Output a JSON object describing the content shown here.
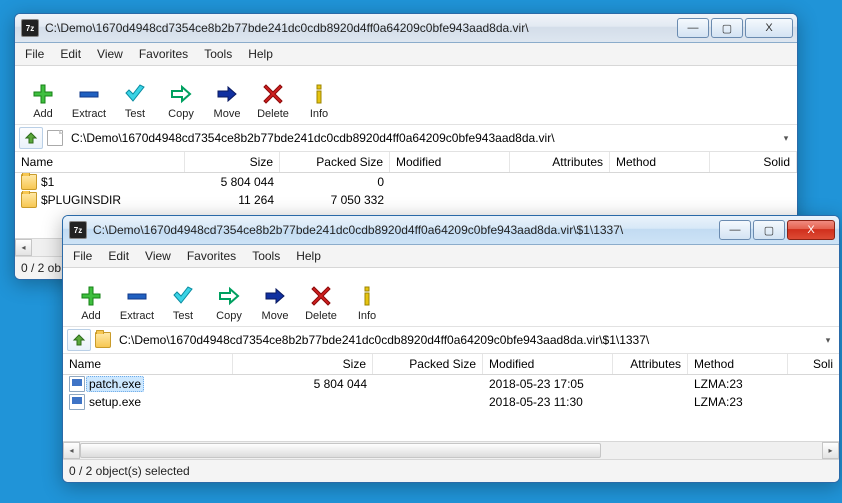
{
  "app_icon_label": "7z",
  "window1": {
    "title": "C:\\Demo\\1670d4948cd7354ce8b2b77bde241dc0cdb8920d4ff0a64209c0bfe943aad8da.vir\\",
    "win_min": "—",
    "win_max": "▢",
    "win_close": "X",
    "menu": [
      "File",
      "Edit",
      "View",
      "Favorites",
      "Tools",
      "Help"
    ],
    "tools": {
      "add": "Add",
      "extract": "Extract",
      "test": "Test",
      "copy": "Copy",
      "move": "Move",
      "delete": "Delete",
      "info": "Info"
    },
    "path": "C:\\Demo\\1670d4948cd7354ce8b2b77bde241dc0cdb8920d4ff0a64209c0bfe943aad8da.vir\\",
    "columns": {
      "name": "Name",
      "size": "Size",
      "packed": "Packed Size",
      "modified": "Modified",
      "attributes": "Attributes",
      "method": "Method",
      "solid": "Solid"
    },
    "rows": [
      {
        "name": "$1",
        "size": "5 804 044",
        "packed": "0",
        "modified": "",
        "attributes": "",
        "method": "",
        "solid": ""
      },
      {
        "name": "$PLUGINSDIR",
        "size": "11 264",
        "packed": "7 050 332",
        "modified": "",
        "attributes": "",
        "method": "",
        "solid": ""
      }
    ],
    "status_prefix": "0 / 2 ob"
  },
  "window2": {
    "title": "C:\\Demo\\1670d4948cd7354ce8b2b77bde241dc0cdb8920d4ff0a64209c0bfe943aad8da.vir\\$1\\1337\\",
    "win_min": "—",
    "win_max": "▢",
    "win_close": "X",
    "menu": [
      "File",
      "Edit",
      "View",
      "Favorites",
      "Tools",
      "Help"
    ],
    "tools": {
      "add": "Add",
      "extract": "Extract",
      "test": "Test",
      "copy": "Copy",
      "move": "Move",
      "delete": "Delete",
      "info": "Info"
    },
    "path": "C:\\Demo\\1670d4948cd7354ce8b2b77bde241dc0cdb8920d4ff0a64209c0bfe943aad8da.vir\\$1\\1337\\",
    "columns": {
      "name": "Name",
      "size": "Size",
      "packed": "Packed Size",
      "modified": "Modified",
      "attributes": "Attributes",
      "method": "Method",
      "solid": "Soli"
    },
    "rows": [
      {
        "name": "patch.exe",
        "size": "5 804 044",
        "packed": "",
        "modified": "2018-05-23 17:05",
        "attributes": "",
        "method": "LZMA:23",
        "solid": "",
        "selected": true
      },
      {
        "name": "setup.exe",
        "size": "",
        "packed": "",
        "modified": "2018-05-23 11:30",
        "attributes": "",
        "method": "LZMA:23",
        "solid": ""
      }
    ],
    "status": "0 / 2 object(s) selected"
  }
}
